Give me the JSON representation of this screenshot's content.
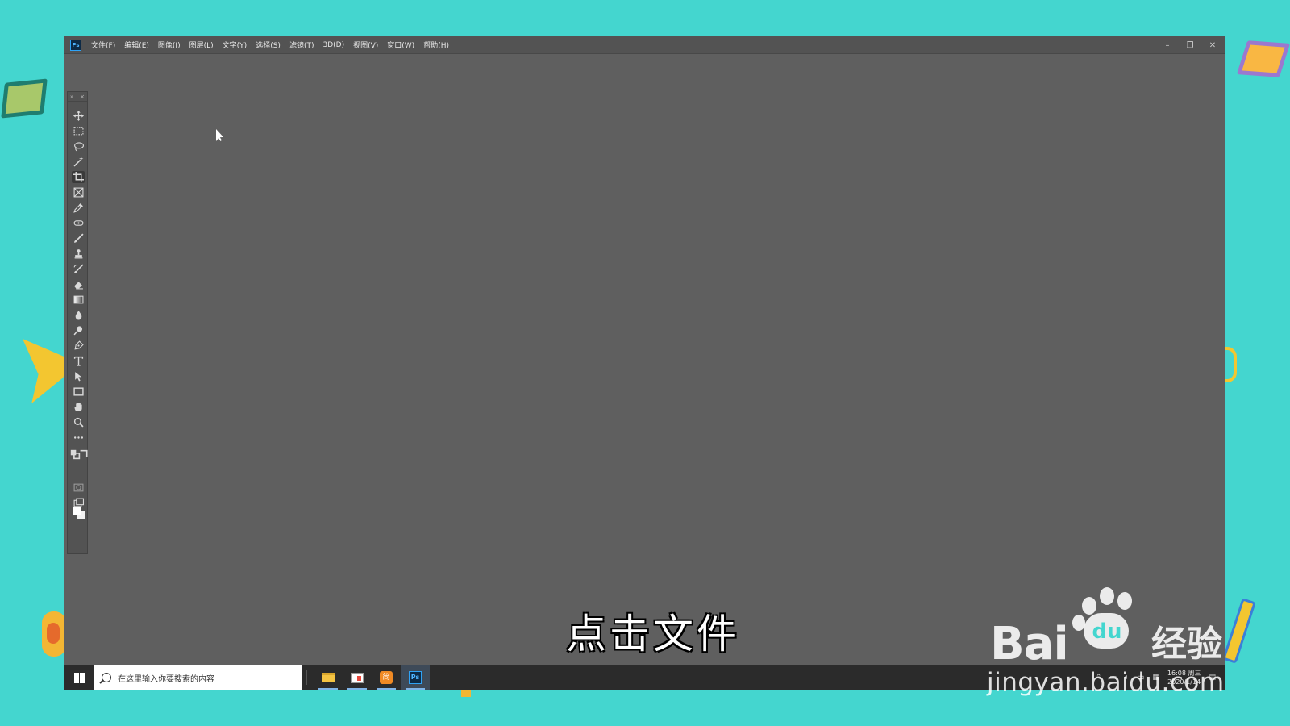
{
  "app": {
    "logo_text": "Ps",
    "menu": [
      "文件(F)",
      "编辑(E)",
      "图像(I)",
      "图层(L)",
      "文字(Y)",
      "选择(S)",
      "滤镜(T)",
      "3D(D)",
      "视图(V)",
      "窗口(W)",
      "帮助(H)"
    ],
    "window_controls": {
      "minimize": "–",
      "restore": "❐",
      "close": "✕"
    }
  },
  "tools_panel": {
    "collapse_glyph": "»",
    "close_glyph": "×",
    "tools": [
      {
        "name": "move-tool",
        "icon": "move-icon"
      },
      {
        "name": "marquee-tool",
        "icon": "rectangle-marquee-icon"
      },
      {
        "name": "lasso-tool",
        "icon": "lasso-icon"
      },
      {
        "name": "magic-wand-tool",
        "icon": "magic-wand-icon"
      },
      {
        "name": "crop-tool",
        "icon": "crop-icon"
      },
      {
        "name": "frame-tool",
        "icon": "frame-icon"
      },
      {
        "name": "eyedropper-tool",
        "icon": "eyedropper-icon"
      },
      {
        "name": "healing-brush-tool",
        "icon": "healing-brush-icon"
      },
      {
        "name": "brush-tool",
        "icon": "brush-icon"
      },
      {
        "name": "clone-stamp-tool",
        "icon": "stamp-icon"
      },
      {
        "name": "history-brush-tool",
        "icon": "history-brush-icon"
      },
      {
        "name": "eraser-tool",
        "icon": "eraser-icon"
      },
      {
        "name": "gradient-tool",
        "icon": "gradient-icon"
      },
      {
        "name": "blur-tool",
        "icon": "blur-drop-icon"
      },
      {
        "name": "dodge-tool",
        "icon": "dodge-icon"
      },
      {
        "name": "pen-tool",
        "icon": "pen-icon"
      },
      {
        "name": "type-tool",
        "icon": "type-icon"
      },
      {
        "name": "path-selection-tool",
        "icon": "path-selection-icon"
      },
      {
        "name": "rectangle-tool",
        "icon": "rectangle-icon"
      },
      {
        "name": "hand-tool",
        "icon": "hand-icon"
      },
      {
        "name": "zoom-tool",
        "icon": "zoom-icon"
      },
      {
        "name": "more-tools",
        "icon": "ellipsis-icon"
      }
    ],
    "foreground_color": "#ffffff",
    "background_color": "#f2f2f2"
  },
  "subtitle": "点击文件",
  "taskbar": {
    "search_placeholder": "在这里输入你要搜索的内容",
    "apps": [
      "file-explorer",
      "photos",
      "orange-app",
      "photoshop"
    ],
    "ps_label": "Ps",
    "orange_label": "简",
    "clock_time": "16:08 周三",
    "clock_date": "2020/1/14"
  },
  "watermark": {
    "brand": "Bai",
    "brand_du": "du",
    "product": "经验",
    "url": "jingyan.baidu.com"
  },
  "colors": {
    "background": "#44d6cf",
    "workspace": "#5f5f5f",
    "panel": "#535353",
    "taskbar": "#2b2b2b",
    "ps_blue": "#2fa3f6"
  }
}
